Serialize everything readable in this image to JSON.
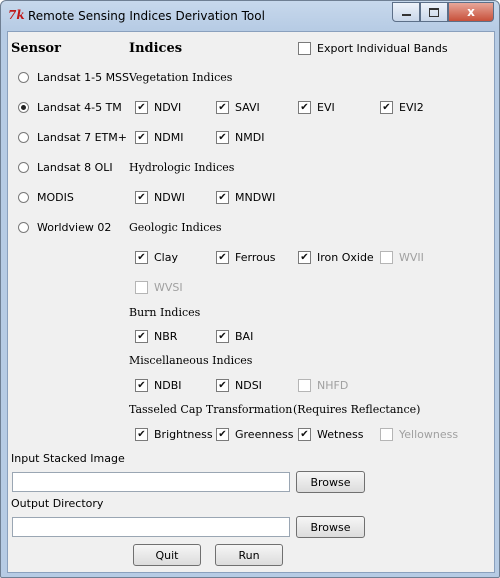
{
  "window": {
    "title": "Remote Sensing Indices Derivation Tool",
    "app_icon": "7k",
    "close_glyph": "x"
  },
  "sensor": {
    "heading": "Sensor",
    "options": [
      "Landsat 1-5 MSS",
      "Landsat 4-5 TM",
      "Landsat 7 ETM+",
      "Landsat 8 OLI",
      "MODIS",
      "Worldview 02"
    ],
    "selected": "Landsat 4-5 TM"
  },
  "indices": {
    "heading": "Indices",
    "export_label": "Export Individual Bands"
  },
  "vegetation": {
    "heading": "Vegetation Indices",
    "items": [
      "NDVI",
      "SAVI",
      "EVI",
      "EVI2",
      "NDMI",
      "NMDI"
    ]
  },
  "hydrologic": {
    "heading": "Hydrologic Indices",
    "items": [
      "NDWI",
      "MNDWI"
    ]
  },
  "geologic": {
    "heading": "Geologic Indices",
    "items": [
      "Clay",
      "Ferrous",
      "Iron Oxide",
      "WVII",
      "WVSI"
    ]
  },
  "burn": {
    "heading": "Burn Indices",
    "items": [
      "NBR",
      "BAI"
    ]
  },
  "misc": {
    "heading": "Miscellaneous Indices",
    "items": [
      "NDBI",
      "NDSI",
      "NHFD"
    ]
  },
  "tasseled": {
    "heading": "Tasseled Cap Transformation",
    "note": "(Requires Reflectance)",
    "items": [
      "Brightness",
      "Greenness",
      "Wetness",
      "Yellowness"
    ]
  },
  "input": {
    "label": "Input Stacked Image",
    "value": "",
    "browse_label": "Browse"
  },
  "output": {
    "label": "Output Directory",
    "value": "",
    "browse_label": "Browse"
  },
  "actions": {
    "quit_label": "Quit",
    "run_label": "Run"
  },
  "check_glyph": "✔"
}
